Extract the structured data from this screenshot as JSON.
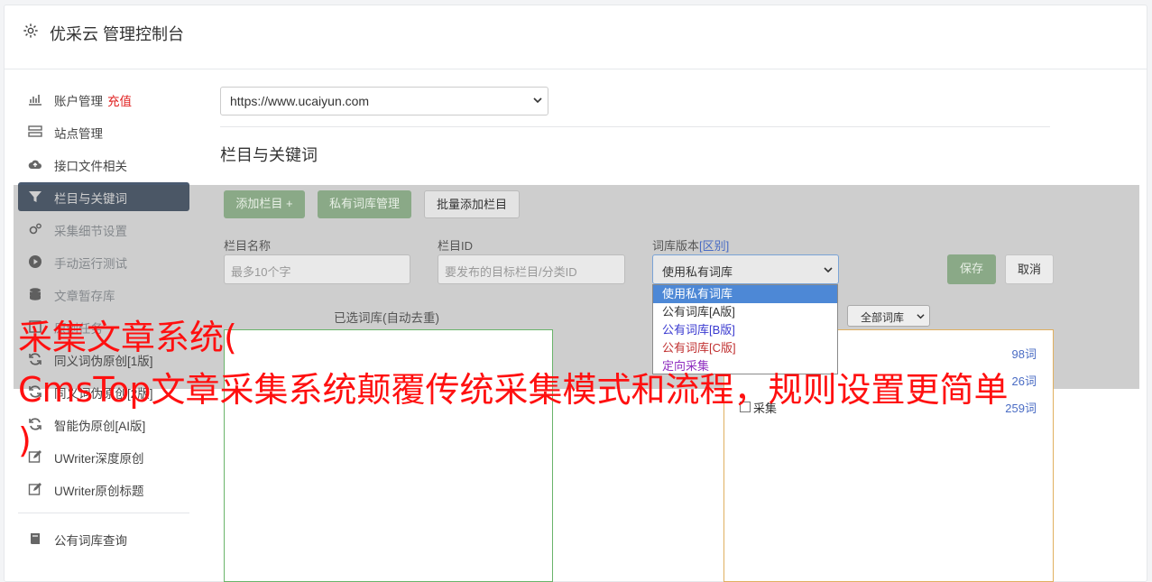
{
  "header": {
    "title": "优采云 管理控制台",
    "icon": "gear-icon"
  },
  "sidebar": {
    "items": [
      {
        "label": "账户管理",
        "extra": "充值",
        "icon": "bar-chart-icon"
      },
      {
        "label": "站点管理",
        "icon": "server-icon"
      },
      {
        "label": "接口文件相关",
        "icon": "cloud-upload-icon"
      },
      {
        "label": "栏目与关键词",
        "icon": "filter-icon",
        "active": true
      },
      {
        "label": "采集细节设置",
        "icon": "gears-icon"
      },
      {
        "label": "手动运行测试",
        "icon": "play-circle-icon"
      },
      {
        "label": "文章暂存库",
        "icon": "database-icon"
      },
      {
        "label": "原创任务",
        "icon": "task-icon"
      },
      {
        "label": "同义词伪原创[1版]",
        "icon": "refresh-icon"
      },
      {
        "label": "同义词伪原创[2版]",
        "icon": "refresh-icon"
      },
      {
        "label": "智能伪原创[AI版]",
        "icon": "refresh-icon"
      },
      {
        "label": "UWriter深度原创",
        "icon": "edit-icon"
      },
      {
        "label": "UWriter原创标题",
        "icon": "edit-icon"
      }
    ],
    "bottom_items": [
      {
        "label": "公有词库查询",
        "icon": "book-icon"
      }
    ]
  },
  "main": {
    "site_select": {
      "value": "https://www.ucaiyun.com"
    },
    "section_title": "栏目与关键词",
    "buttons": {
      "add_column": "添加栏目 +",
      "private_lib": "私有词库管理",
      "batch_add": "批量添加栏目",
      "save": "保存",
      "cancel": "取消"
    },
    "fields": {
      "column_name": {
        "label": "栏目名称",
        "placeholder": "最多10个字"
      },
      "column_id": {
        "label": "栏目ID",
        "placeholder": "要发布的目标栏目/分类ID"
      },
      "lib_version": {
        "label": "词库版本",
        "label_link": "[区别]",
        "value": "使用私有词库"
      }
    },
    "lib_version_options": [
      {
        "label": "使用私有词库",
        "color": "#ffffff",
        "selected": true
      },
      {
        "label": "公有词库[A版]",
        "color": "#333333"
      },
      {
        "label": "公有词库[B版]",
        "color": "#3a3ad0"
      },
      {
        "label": "公有词库[C版]",
        "color": "#c03030"
      },
      {
        "label": "定向采集",
        "color": "#9030c0"
      }
    ],
    "selected_panel_title": "已选词库(自动去重)",
    "filter_select": "全部词库",
    "library_rows": [
      {
        "label": "",
        "count": "98词"
      },
      {
        "label": "",
        "count": "26词"
      },
      {
        "label": "采集",
        "count": "259词"
      }
    ]
  },
  "watermark": {
    "line1": "采集文章系统(",
    "line2": "CmsTop文章采集系统颠覆传统采集模式和流程，规则设置更简单",
    "line3": ")"
  }
}
